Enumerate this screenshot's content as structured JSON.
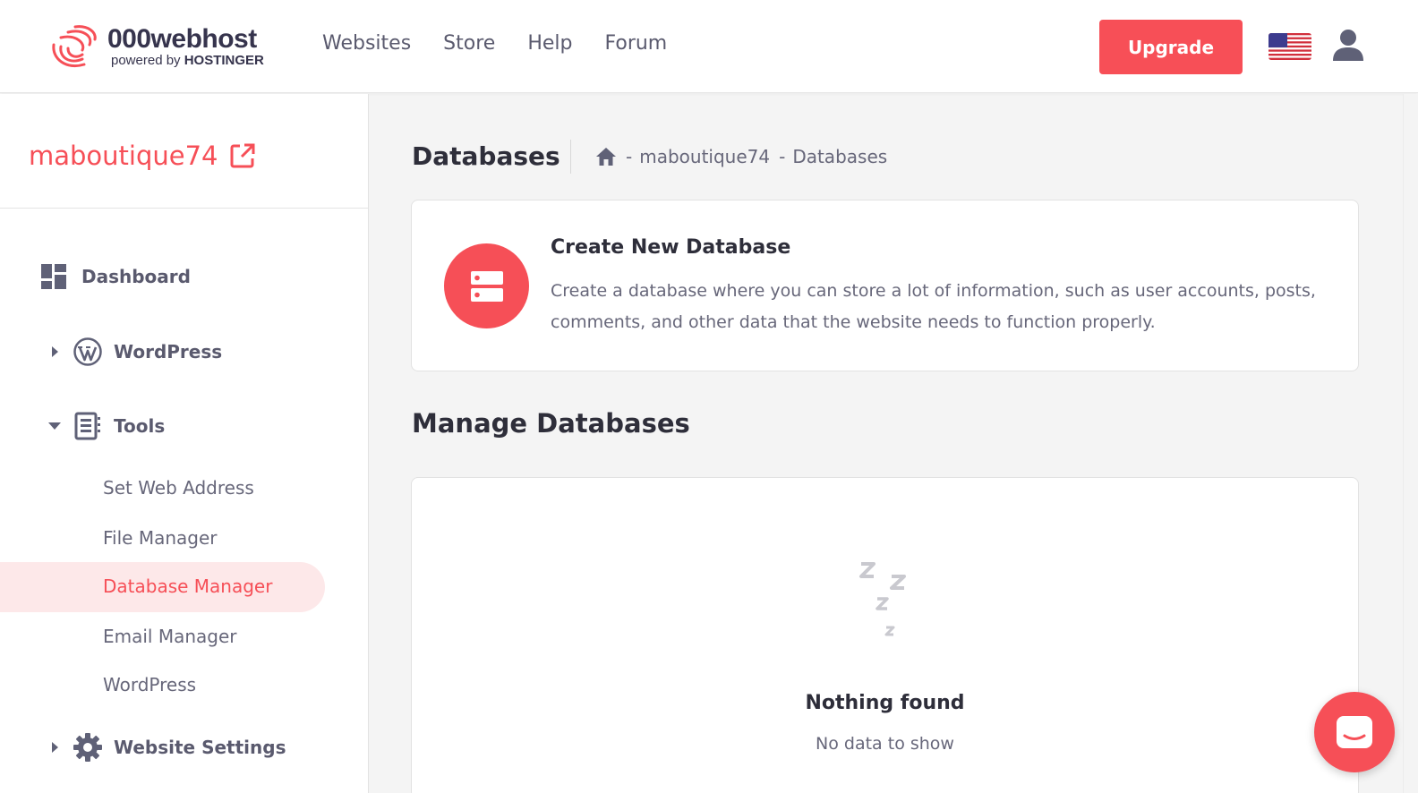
{
  "header": {
    "logo_name": "000webhost",
    "logo_sub_prefix": "powered by ",
    "logo_sub_brand": "HOSTINGER",
    "nav": [
      "Websites",
      "Store",
      "Help",
      "Forum"
    ],
    "upgrade_label": "Upgrade",
    "language_icon": "us-flag-icon",
    "account_icon": "user-icon"
  },
  "sidebar": {
    "site_name": "maboutique74",
    "items": [
      {
        "label": "Dashboard",
        "icon": "dashboard-icon"
      },
      {
        "label": "WordPress",
        "icon": "wordpress-icon",
        "expanded": false
      },
      {
        "label": "Tools",
        "icon": "tools-icon",
        "expanded": true
      },
      {
        "label": "Website Settings",
        "icon": "gear-icon",
        "expanded": false
      }
    ],
    "tools_subitems": [
      "Set Web Address",
      "File Manager",
      "Database Manager",
      "Email Manager",
      "WordPress"
    ],
    "active_subitem": "Database Manager"
  },
  "main": {
    "page_title": "Databases",
    "breadcrumb": [
      "maboutique74",
      "Databases"
    ],
    "breadcrumb_separator": "-",
    "create": {
      "title": "Create New Database",
      "description": "Create a database where you can store a lot of information, such as user accounts, posts, comments, and other data that the website needs to function properly."
    },
    "manage_title": "Manage Databases",
    "empty": {
      "title": "Nothing found",
      "subtitle": "No data to show"
    }
  },
  "colors": {
    "accent": "#f64f57",
    "accent_light": "#fde8e9",
    "text_dark": "#2e2e3a",
    "text_muted": "#67677a"
  }
}
